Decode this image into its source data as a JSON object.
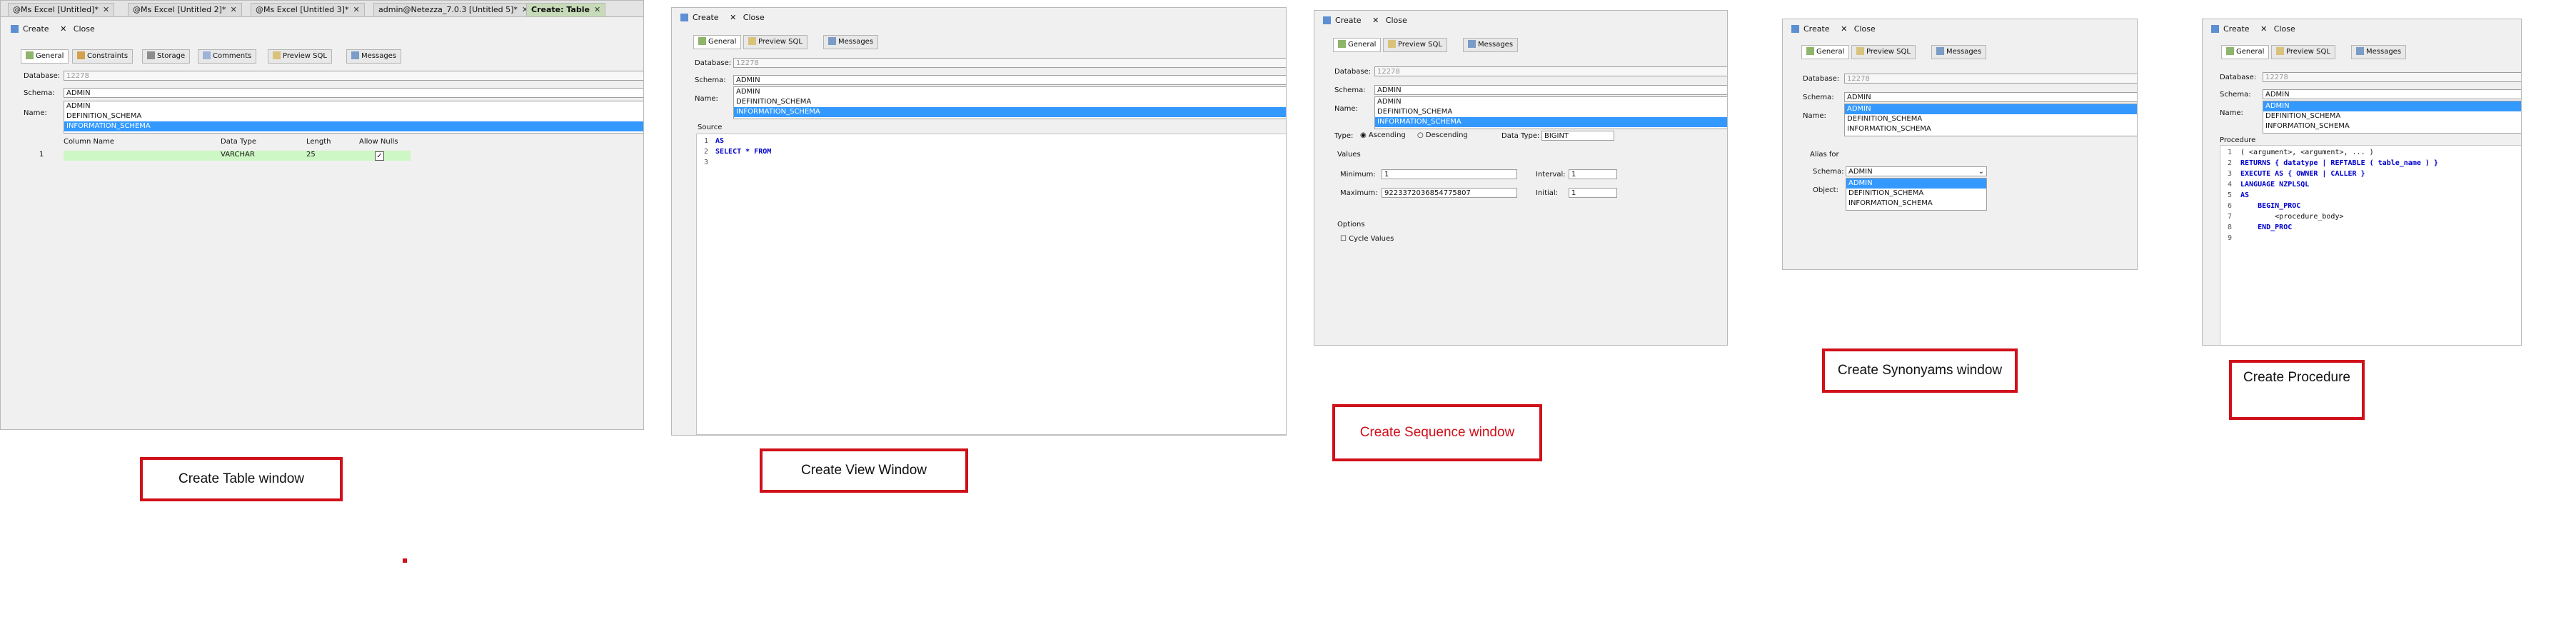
{
  "table_window": {
    "doc_tabs": [
      {
        "label": "@Ms Excel [Untitled]*",
        "active": false
      },
      {
        "label": "@Ms Excel [Untitled 2]*",
        "active": false
      },
      {
        "label": "@Ms Excel [Untitled 3]*",
        "active": false
      },
      {
        "label": "admin@Netezza_7.0.3 [Untitled 5]*",
        "active": false
      },
      {
        "label": "Create: Table",
        "active": true
      }
    ],
    "toolbar": {
      "create": "Create",
      "close": "Close"
    },
    "tabs": [
      "General",
      "Constraints",
      "Storage",
      "Comments",
      "Preview SQL",
      "Messages"
    ],
    "database_label": "Database:",
    "database_value": "12278",
    "schema_label": "Schema:",
    "schema_value": "ADMIN",
    "name_label": "Name:",
    "schema_options": [
      "ADMIN",
      "DEFINITION_SCHEMA",
      "INFORMATION_SCHEMA"
    ],
    "selected_option": "INFORMATION_SCHEMA",
    "columns": [
      "Column Name",
      "Data Type",
      "Length",
      "Allow Nulls"
    ],
    "rows": [
      {
        "num": "1",
        "name": "",
        "type": "VARCHAR",
        "length": "25",
        "allow_nulls": true
      }
    ]
  },
  "view_window": {
    "toolbar": {
      "create": "Create",
      "close": "Close"
    },
    "tabs": [
      "General",
      "Preview SQL",
      "Messages"
    ],
    "database_label": "Database:",
    "database_value": "12278",
    "schema_label": "Schema:",
    "schema_value": "ADMIN",
    "name_label": "Name:",
    "schema_options": [
      "ADMIN",
      "DEFINITION_SCHEMA",
      "INFORMATION_SCHEMA"
    ],
    "selected_option": "INFORMATION_SCHEMA",
    "source_label": "Source",
    "code_lines": [
      "AS",
      "SELECT * FROM",
      ""
    ]
  },
  "sequence_window": {
    "toolbar": {
      "create": "Create",
      "close": "Close"
    },
    "tabs": [
      "General",
      "Preview SQL",
      "Messages"
    ],
    "database_label": "Database:",
    "database_value": "12278",
    "schema_label": "Schema:",
    "schema_value": "ADMIN",
    "name_label": "Name:",
    "schema_options": [
      "ADMIN",
      "DEFINITION_SCHEMA",
      "INFORMATION_SCHEMA"
    ],
    "selected_option": "INFORMATION_SCHEMA",
    "type_label": "Type:",
    "ascending": "Ascending",
    "descending": "Descending",
    "data_type_label": "Data Type:",
    "data_type_value": "BIGINT",
    "values_label": "Values",
    "minimum_label": "Minimum:",
    "minimum_value": "1",
    "maximum_label": "Maximum:",
    "maximum_value": "9223372036854775807",
    "interval_label": "Interval:",
    "interval_value": "1",
    "initial_label": "Initial:",
    "initial_value": "1",
    "options_label": "Options",
    "cycle_label": "Cycle Values"
  },
  "synonyms_window": {
    "toolbar": {
      "create": "Create",
      "close": "Close"
    },
    "tabs": [
      "General",
      "Preview SQL",
      "Messages"
    ],
    "database_label": "Database:",
    "database_value": "12278",
    "schema_label": "Schema:",
    "schema_value": "ADMIN",
    "name_label": "Name:",
    "schema_options": [
      "ADMIN",
      "DEFINITION_SCHEMA",
      "INFORMATION_SCHEMA"
    ],
    "selected_option": "ADMIN",
    "alias_label": "Alias for",
    "alias_schema_label": "Schema:",
    "alias_schema_value": "ADMIN",
    "object_label": "Object:",
    "alias_options": [
      "ADMIN",
      "DEFINITION_SCHEMA",
      "INFORMATION_SCHEMA"
    ],
    "alias_selected": "ADMIN"
  },
  "procedure_window": {
    "toolbar": {
      "create": "Create",
      "close": "Close"
    },
    "tabs": [
      "General",
      "Preview SQL",
      "Messages"
    ],
    "database_label": "Database:",
    "database_value": "12278",
    "schema_label": "Schema:",
    "schema_value": "ADMIN",
    "name_label": "Name:",
    "schema_options": [
      "ADMIN",
      "DEFINITION_SCHEMA",
      "INFORMATION_SCHEMA"
    ],
    "selected_option": "ADMIN",
    "procedure_label": "Procedure",
    "code_lines": [
      "( <argument>, <argument>, ... )",
      "RETURNS { datatype | REFTABLE ( table_name ) }",
      "EXECUTE AS { OWNER | CALLER }",
      "LANGUAGE NZPLSQL",
      "AS",
      "    BEGIN_PROC",
      "        <procedure_body>",
      "    END_PROC",
      ""
    ]
  },
  "captions": {
    "table": "Create Table window",
    "view": "Create View Window",
    "sequence": "Create Sequence window",
    "synonyms": "Create Synonyams window",
    "procedure": "Create Procedure"
  },
  "colors": {
    "selection": "#3399ff",
    "caption_border": "#d0101a",
    "keyword": "#0000cc",
    "active_row": "#cdf7c4"
  }
}
